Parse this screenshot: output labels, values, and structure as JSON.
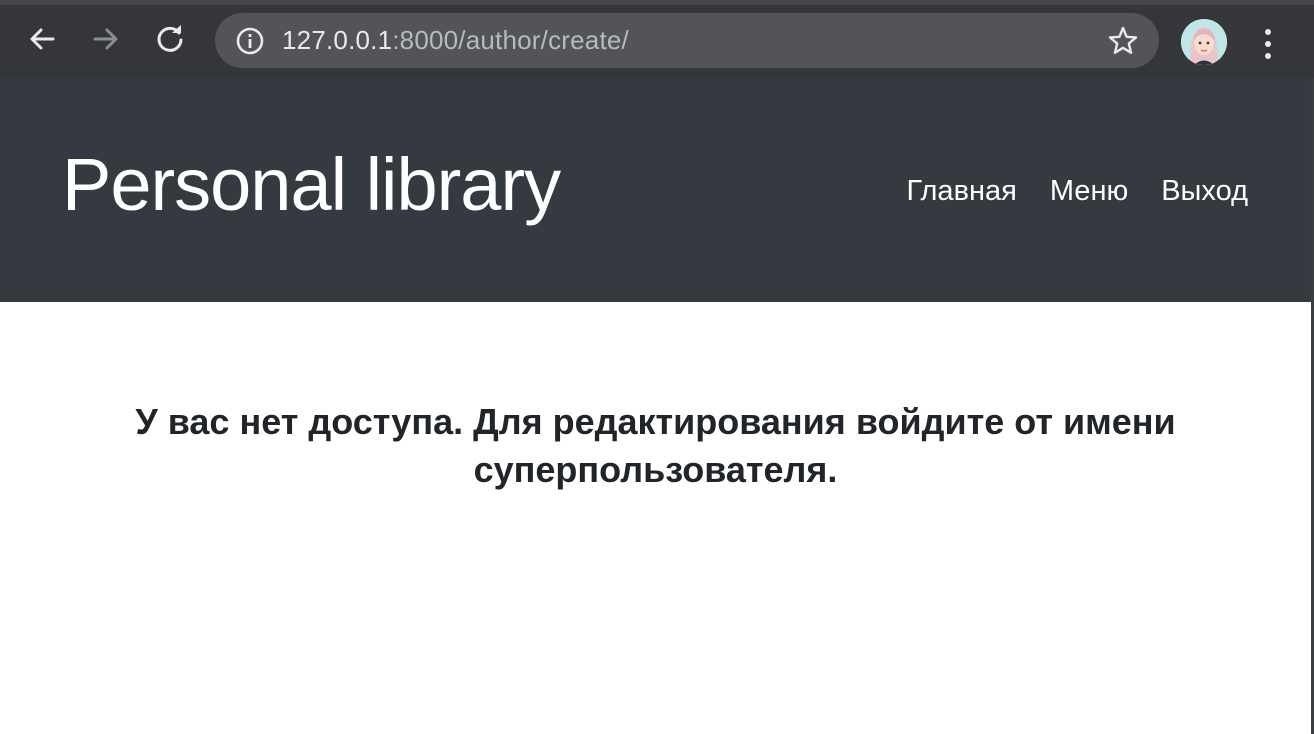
{
  "browser": {
    "url_host": "127.0.0.1",
    "url_rest": ":8000/author/create/",
    "icons": {
      "back": "arrow-left-icon",
      "forward": "arrow-right-icon",
      "reload": "reload-icon",
      "info": "info-icon",
      "bookmark": "star-icon",
      "menu": "kebab-menu-icon"
    }
  },
  "header": {
    "brand": "Personal library",
    "nav": [
      {
        "label": "Главная"
      },
      {
        "label": "Меню"
      },
      {
        "label": "Выход"
      }
    ]
  },
  "main": {
    "message_line1": "У вас нет доступа. Для редактирования войдите от имени",
    "message_line2": "суперпользователя."
  },
  "colors": {
    "browser_toolbar": "#35363a",
    "omnibox": "#525458",
    "header_bg": "#343a40",
    "text_dark": "#212529"
  }
}
